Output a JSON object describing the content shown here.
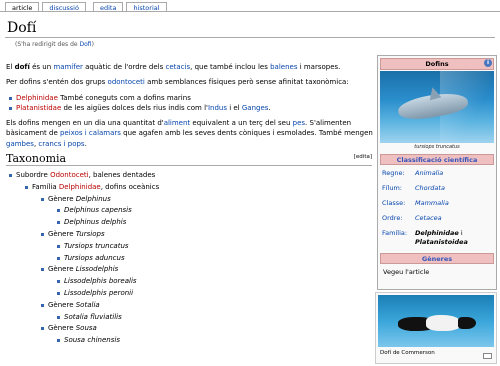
{
  "tabs": [
    {
      "label": "article",
      "selected": true
    },
    {
      "label": "discussió",
      "selected": false
    },
    {
      "label": "edita",
      "selected": false
    },
    {
      "label": "historial",
      "selected": false
    }
  ],
  "page": {
    "title": "Dofí",
    "redirect_prefix": "(S'ha redirigit des de ",
    "redirect_link": "Dofi",
    "redirect_suffix": ")"
  },
  "intro": {
    "p1": [
      "El ",
      "dofí",
      " és un ",
      "mamífer",
      " aquàtic de l'ordre dels ",
      "cetacis",
      ", que també inclou les ",
      "balenes",
      " i marsopes."
    ],
    "p2": "Per dofins s'entén dos grups odontoceti amb semblances físiques però sense afinitat taxonòmica:",
    "p2_link": "odontoceti",
    "p2_before": "Per dofins s'entén dos grups ",
    "p2_after": " amb semblances físiques però sense afinitat taxonòmica:",
    "groups": [
      {
        "link": "Delphinidae",
        "rest": " També coneguts com a dofins marins"
      },
      {
        "link": "Platanistidae",
        "rest_a": " de les aigües dolces dels rius indis com l'",
        "link_b": "Indus",
        "rest_b": " i el ",
        "link_c": "Ganges",
        "rest_c": "."
      }
    ],
    "p3_a": "Els dofins mengen en un dia una quantitat d'",
    "p3_link1": "aliment",
    "p3_b": " equivalent a un terç del seu ",
    "p3_link2": "pes",
    "p3_c": ". S'alimenten bàsicament de ",
    "p3_link3": "peixos i calamars",
    "p3_d": " que agafen amb les seves dents còniques i esmolades. També mengen ",
    "p3_link4": "gambes",
    "p3_e": ", ",
    "p3_link5": "crancs i pops",
    "p3_f": "."
  },
  "taxonomy": {
    "heading": "Taxonomia",
    "edit": "[edita]",
    "rows": [
      {
        "indent": 0,
        "pre": "Subordre ",
        "link": "Odontoceti",
        "post": ", balenes dentades"
      },
      {
        "indent": 1,
        "pre": "Família ",
        "link": "Delphinidae",
        "post": ", dofins oceànics"
      },
      {
        "indent": 2,
        "pre": "Gènere ",
        "italic": "Delphinus"
      },
      {
        "indent": 3,
        "italic": "Delphinus capensis"
      },
      {
        "indent": 3,
        "italic": "Delphinus delphis"
      },
      {
        "indent": 2,
        "pre": "Gènere ",
        "italic": "Tursiops"
      },
      {
        "indent": 3,
        "italic": "Tursiops truncatus"
      },
      {
        "indent": 3,
        "italic": "Tursiops aduncus"
      },
      {
        "indent": 2,
        "pre": "Gènere ",
        "italic": "Lissodelphis"
      },
      {
        "indent": 3,
        "italic": "Lissodelphis borealis"
      },
      {
        "indent": 3,
        "italic": "Lissodelphis peronii"
      },
      {
        "indent": 2,
        "pre": "Gènere ",
        "italic": "Sotalia"
      },
      {
        "indent": 3,
        "italic": "Sotalia fluviatilis"
      },
      {
        "indent": 2,
        "pre": "Gènere ",
        "italic": "Sousa"
      },
      {
        "indent": 3,
        "italic": "Sousa chinensis"
      }
    ]
  },
  "infobox": {
    "title": "Dofins",
    "info_icon": "i",
    "caption": "tursiops truncatus",
    "classification_heading": "Classificació científica",
    "rows": [
      {
        "label": "Regne:",
        "value": "Animalia"
      },
      {
        "label": "Fílum:",
        "value": "Chordata"
      },
      {
        "label": "Classe:",
        "value": "Mammalia"
      },
      {
        "label": "Ordre:",
        "value": "Cetacea"
      }
    ],
    "family_label": "Família:",
    "family_value_1": "Delphinidae",
    "family_value_join": " i ",
    "family_value_2": "Platanistoidea",
    "genera_heading": "Gèneres",
    "genera_text": "Vegeu l'article"
  },
  "thumbnail": {
    "caption": "Dofí de Commerson"
  }
}
